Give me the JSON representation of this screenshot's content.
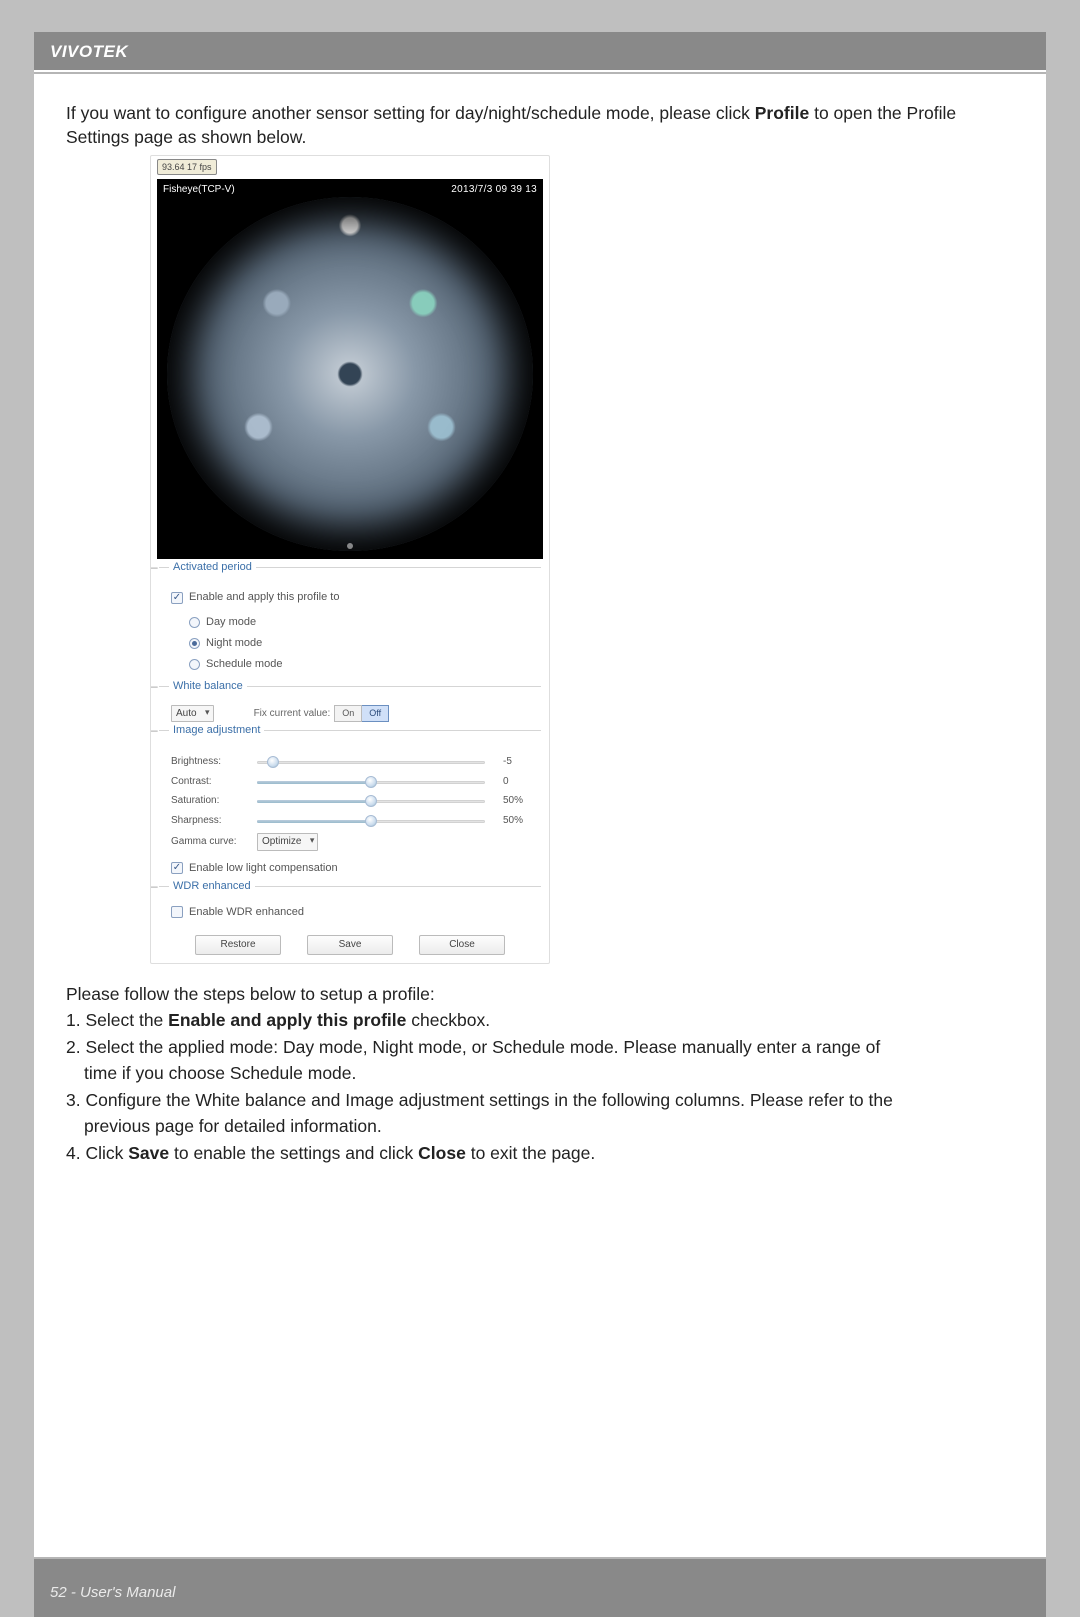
{
  "header": {
    "brand": "VIVOTEK"
  },
  "intro": {
    "line1a": "If you want to configure another sensor setting for day/night/schedule mode, please click ",
    "profile_word": "Profile",
    "line1b": " to open the Profile Settings page as shown below."
  },
  "panel": {
    "fps_badge": "93.64  17 fps",
    "video_title": "Fisheye(TCP-V)",
    "video_time": "2013/7/3 09 39 13",
    "sections": {
      "activated": {
        "title": "Activated period",
        "enable_label": "Enable and apply this profile to",
        "radios": {
          "day": "Day mode",
          "night": "Night mode",
          "schedule": "Schedule mode"
        },
        "selected": "night"
      },
      "white_balance": {
        "title": "White balance",
        "select_value": "Auto",
        "fix_label": "Fix current value:",
        "on": "On",
        "off": "Off"
      },
      "image_adjustment": {
        "title": "Image adjustment",
        "sliders": [
          {
            "label": "Brightness:",
            "value": "-5",
            "pct": 7
          },
          {
            "label": "Contrast:",
            "value": "0",
            "pct": 50
          },
          {
            "label": "Saturation:",
            "value": "50%",
            "pct": 50
          },
          {
            "label": "Sharpness:",
            "value": "50%",
            "pct": 50
          }
        ],
        "gamma_label": "Gamma curve:",
        "gamma_value": "Optimize",
        "low_light_label": "Enable low light compensation"
      },
      "wdr": {
        "title": "WDR enhanced",
        "checkbox_label": "Enable WDR enhanced"
      }
    },
    "buttons": {
      "restore": "Restore",
      "save": "Save",
      "close": "Close"
    }
  },
  "steps": {
    "intro": "Please follow the steps below to setup a profile:",
    "s1a": "1. Select the ",
    "s1b": "Enable and apply this profile",
    "s1c": " checkbox.",
    "s2": "2. Select the applied mode: Day mode, Night mode, or Schedule mode. Please manually enter a range of",
    "s2b": "time if you choose Schedule mode.",
    "s3": "3. Configure the White balance and Image adjustment settings in the following columns. Please refer to the",
    "s3b": "previous page for detailed information.",
    "s4a": "4. Click ",
    "s4_save": "Save",
    "s4b": " to enable the settings and click ",
    "s4_close": "Close",
    "s4c": " to exit the page."
  },
  "footer": {
    "page_no": "52",
    "sep": " - ",
    "label": "User's Manual"
  }
}
